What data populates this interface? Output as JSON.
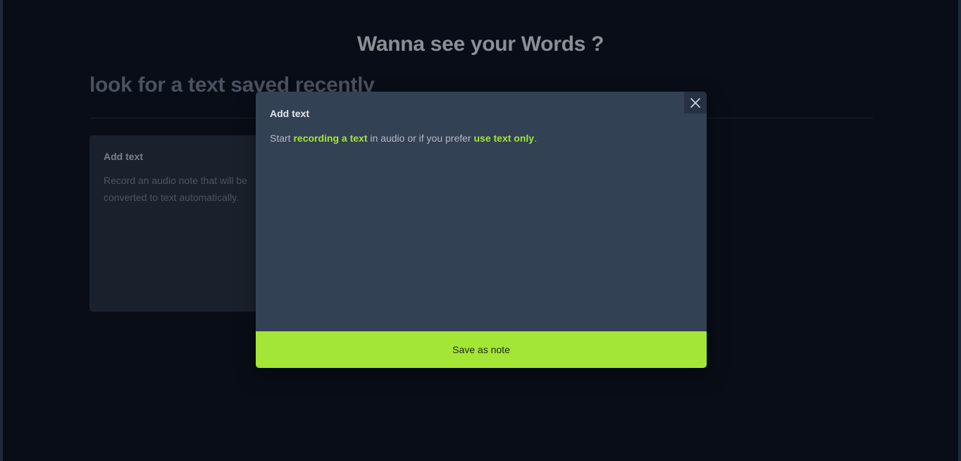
{
  "page": {
    "title": "Wanna see your Words ?",
    "section_heading": "look for a text saved recently"
  },
  "card": {
    "title": "Add text",
    "description": "Record an audio note that will be converted to text automatically."
  },
  "modal": {
    "title": "Add text",
    "body": {
      "prefix": "Start ",
      "link_record": "recording a text",
      "middle": " in audio or if you prefer ",
      "link_text_only": "use text only",
      "suffix": "."
    },
    "close_icon": "close-icon",
    "save_label": "Save as note"
  },
  "colors": {
    "accent": "#a3e635",
    "background": "#080d17",
    "modal_bg": "#334155"
  }
}
